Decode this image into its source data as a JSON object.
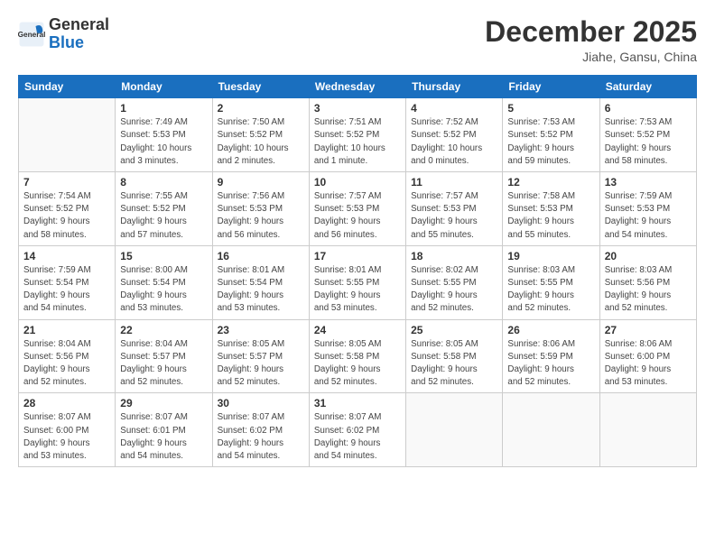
{
  "header": {
    "logo_general": "General",
    "logo_blue": "Blue",
    "month_title": "December 2025",
    "location": "Jiahe, Gansu, China"
  },
  "calendar": {
    "days_of_week": [
      "Sunday",
      "Monday",
      "Tuesday",
      "Wednesday",
      "Thursday",
      "Friday",
      "Saturday"
    ],
    "weeks": [
      [
        {
          "day": "",
          "info": ""
        },
        {
          "day": "1",
          "info": "Sunrise: 7:49 AM\nSunset: 5:53 PM\nDaylight: 10 hours\nand 3 minutes."
        },
        {
          "day": "2",
          "info": "Sunrise: 7:50 AM\nSunset: 5:52 PM\nDaylight: 10 hours\nand 2 minutes."
        },
        {
          "day": "3",
          "info": "Sunrise: 7:51 AM\nSunset: 5:52 PM\nDaylight: 10 hours\nand 1 minute."
        },
        {
          "day": "4",
          "info": "Sunrise: 7:52 AM\nSunset: 5:52 PM\nDaylight: 10 hours\nand 0 minutes."
        },
        {
          "day": "5",
          "info": "Sunrise: 7:53 AM\nSunset: 5:52 PM\nDaylight: 9 hours\nand 59 minutes."
        },
        {
          "day": "6",
          "info": "Sunrise: 7:53 AM\nSunset: 5:52 PM\nDaylight: 9 hours\nand 58 minutes."
        }
      ],
      [
        {
          "day": "7",
          "info": "Sunrise: 7:54 AM\nSunset: 5:52 PM\nDaylight: 9 hours\nand 58 minutes."
        },
        {
          "day": "8",
          "info": "Sunrise: 7:55 AM\nSunset: 5:52 PM\nDaylight: 9 hours\nand 57 minutes."
        },
        {
          "day": "9",
          "info": "Sunrise: 7:56 AM\nSunset: 5:53 PM\nDaylight: 9 hours\nand 56 minutes."
        },
        {
          "day": "10",
          "info": "Sunrise: 7:57 AM\nSunset: 5:53 PM\nDaylight: 9 hours\nand 56 minutes."
        },
        {
          "day": "11",
          "info": "Sunrise: 7:57 AM\nSunset: 5:53 PM\nDaylight: 9 hours\nand 55 minutes."
        },
        {
          "day": "12",
          "info": "Sunrise: 7:58 AM\nSunset: 5:53 PM\nDaylight: 9 hours\nand 55 minutes."
        },
        {
          "day": "13",
          "info": "Sunrise: 7:59 AM\nSunset: 5:53 PM\nDaylight: 9 hours\nand 54 minutes."
        }
      ],
      [
        {
          "day": "14",
          "info": "Sunrise: 7:59 AM\nSunset: 5:54 PM\nDaylight: 9 hours\nand 54 minutes."
        },
        {
          "day": "15",
          "info": "Sunrise: 8:00 AM\nSunset: 5:54 PM\nDaylight: 9 hours\nand 53 minutes."
        },
        {
          "day": "16",
          "info": "Sunrise: 8:01 AM\nSunset: 5:54 PM\nDaylight: 9 hours\nand 53 minutes."
        },
        {
          "day": "17",
          "info": "Sunrise: 8:01 AM\nSunset: 5:55 PM\nDaylight: 9 hours\nand 53 minutes."
        },
        {
          "day": "18",
          "info": "Sunrise: 8:02 AM\nSunset: 5:55 PM\nDaylight: 9 hours\nand 52 minutes."
        },
        {
          "day": "19",
          "info": "Sunrise: 8:03 AM\nSunset: 5:55 PM\nDaylight: 9 hours\nand 52 minutes."
        },
        {
          "day": "20",
          "info": "Sunrise: 8:03 AM\nSunset: 5:56 PM\nDaylight: 9 hours\nand 52 minutes."
        }
      ],
      [
        {
          "day": "21",
          "info": "Sunrise: 8:04 AM\nSunset: 5:56 PM\nDaylight: 9 hours\nand 52 minutes."
        },
        {
          "day": "22",
          "info": "Sunrise: 8:04 AM\nSunset: 5:57 PM\nDaylight: 9 hours\nand 52 minutes."
        },
        {
          "day": "23",
          "info": "Sunrise: 8:05 AM\nSunset: 5:57 PM\nDaylight: 9 hours\nand 52 minutes."
        },
        {
          "day": "24",
          "info": "Sunrise: 8:05 AM\nSunset: 5:58 PM\nDaylight: 9 hours\nand 52 minutes."
        },
        {
          "day": "25",
          "info": "Sunrise: 8:05 AM\nSunset: 5:58 PM\nDaylight: 9 hours\nand 52 minutes."
        },
        {
          "day": "26",
          "info": "Sunrise: 8:06 AM\nSunset: 5:59 PM\nDaylight: 9 hours\nand 52 minutes."
        },
        {
          "day": "27",
          "info": "Sunrise: 8:06 AM\nSunset: 6:00 PM\nDaylight: 9 hours\nand 53 minutes."
        }
      ],
      [
        {
          "day": "28",
          "info": "Sunrise: 8:07 AM\nSunset: 6:00 PM\nDaylight: 9 hours\nand 53 minutes."
        },
        {
          "day": "29",
          "info": "Sunrise: 8:07 AM\nSunset: 6:01 PM\nDaylight: 9 hours\nand 54 minutes."
        },
        {
          "day": "30",
          "info": "Sunrise: 8:07 AM\nSunset: 6:02 PM\nDaylight: 9 hours\nand 54 minutes."
        },
        {
          "day": "31",
          "info": "Sunrise: 8:07 AM\nSunset: 6:02 PM\nDaylight: 9 hours\nand 54 minutes."
        },
        {
          "day": "",
          "info": ""
        },
        {
          "day": "",
          "info": ""
        },
        {
          "day": "",
          "info": ""
        }
      ]
    ]
  }
}
